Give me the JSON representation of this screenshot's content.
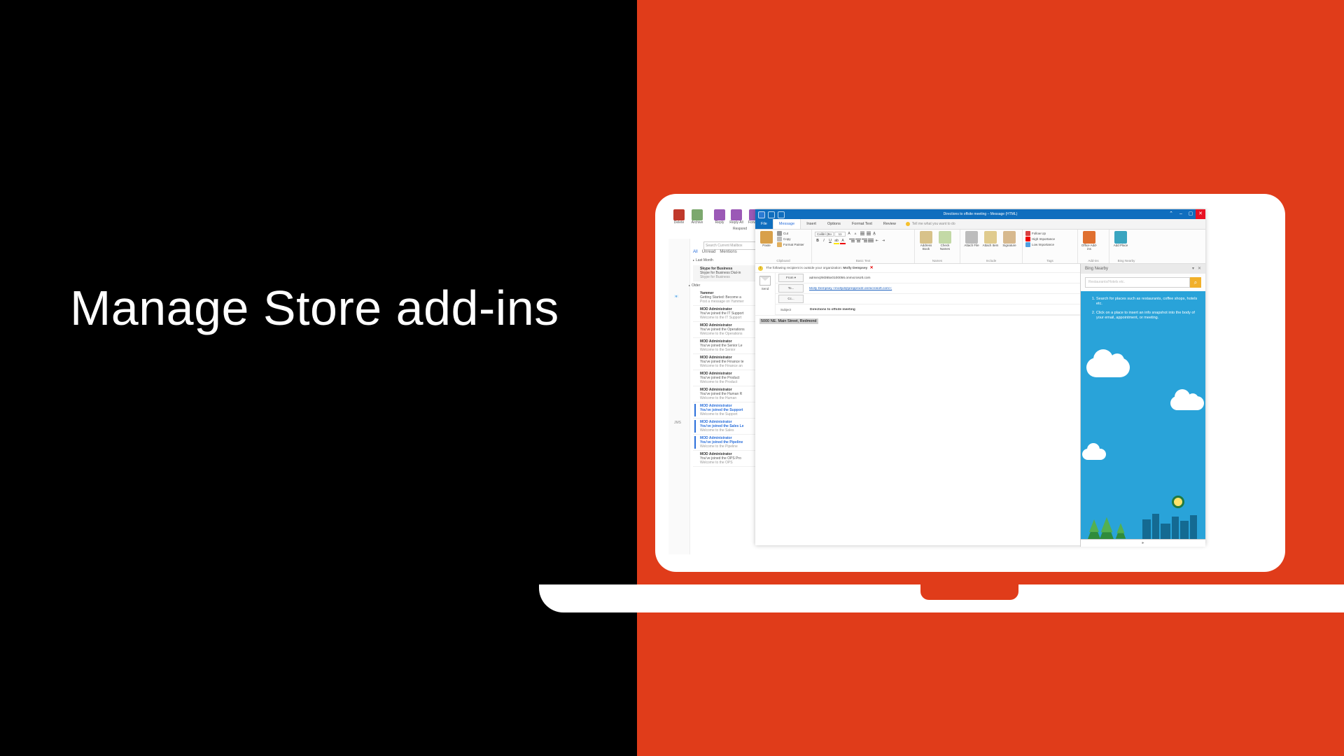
{
  "slide_title": "Manage Store add-ins",
  "outlook_back": {
    "toolbar": [
      {
        "label": "Delete"
      },
      {
        "label": "Archive"
      },
      {
        "label": "Reply"
      },
      {
        "label": "Reply All"
      },
      {
        "label": "Forward"
      }
    ],
    "response_label": "Respond",
    "search_placeholder": "Search Current Mailbox",
    "filters": [
      "All",
      "Unread",
      "Mentions"
    ],
    "group_last_month": "Last Month",
    "group_older": "Older",
    "rail_text_letters": "JMS",
    "messages": [
      {
        "sender": "Skype for Business",
        "subject": "Skype for Business Dial-in",
        "preview": "Skype for Business"
      },
      {
        "sender": "Yammer",
        "subject": "Getting Started: Become a",
        "preview": "Post a message on Yammer"
      },
      {
        "sender": "MOD Administrator",
        "subject": "You've joined the IT Support",
        "preview": "Welcome to the IT Support"
      },
      {
        "sender": "MOD Administrator",
        "subject": "You've joined the Operations",
        "preview": "Welcome to the Operations"
      },
      {
        "sender": "MOD Administrator",
        "subject": "You've joined the Senior Le",
        "preview": "Welcome to the Senior"
      },
      {
        "sender": "MOD Administrator",
        "subject": "You've joined the Finance te",
        "preview": "Welcome to the Finance an"
      },
      {
        "sender": "MOD Administrator",
        "subject": "You've joined the Product",
        "preview": "Welcome to the Product"
      },
      {
        "sender": "MOD Administrator",
        "subject": "You've joined the Human R",
        "preview": "Welcome to the Human"
      },
      {
        "sender": "MOD Administrator",
        "subject": "You've joined the Support",
        "preview": "Welcome to the Support",
        "unread": true
      },
      {
        "sender": "MOD Administrator",
        "subject": "You've joined the Sales Le",
        "preview": "Welcome to the Sales",
        "unread": true
      },
      {
        "sender": "MOD Administrator",
        "subject": "You've joined the Pipeline",
        "preview": "Welcome to the Pipeline",
        "unread": true
      },
      {
        "sender": "MOD Administrator",
        "subject": "You've joined the OPS Pro",
        "preview": "Welcome to the OPS"
      }
    ]
  },
  "compose": {
    "window_title": "Directions to offsite meeting – Message (HTML)",
    "tabs": [
      "File",
      "Message",
      "Insert",
      "Options",
      "Format Text",
      "Review"
    ],
    "tell_me": "Tell me what you want to do",
    "ribbon": {
      "clipboard": {
        "paste": "Paste",
        "cut": "Cut",
        "copy": "Copy",
        "format_painter": "Format Painter",
        "group": "Clipboard"
      },
      "basic_text": {
        "font_name": "Calibri (Bo",
        "font_size": "11",
        "group": "Basic Text"
      },
      "names": {
        "address_book": "Address Book",
        "check_names": "Check Names",
        "group": "Names"
      },
      "include": {
        "attach_file": "Attach File",
        "attach_item": "Attach Item",
        "signature": "Signature",
        "group": "Include"
      },
      "tags": {
        "follow_up": "Follow Up",
        "high_importance": "High Importance",
        "low_importance": "Low Importance",
        "group": "Tags"
      },
      "addins": {
        "office_addins": "Office Add-ins",
        "group": "Add-ins"
      },
      "bing": {
        "add_place": "Add Place",
        "group": "Bing Nearby"
      }
    },
    "info_bar_prefix": "The following recipient is outside your organization:",
    "info_bar_name": "Molly Dempsey",
    "from_label": "From",
    "from_value": "admin@M365x0100056.onmicrosoft.com",
    "to_label": "To...",
    "to_value": "Molly Dempsey <mollyd@prepprod2.onmicrosoft.com>;",
    "cc_label": "Cc...",
    "cc_value": "",
    "subject_label": "Subject",
    "subject_value": "Directions to offsite meeting",
    "send_label": "Send",
    "body_selected_text": "5000 NE. Main Street, Redmond"
  },
  "bing_pane": {
    "title": "Bing Nearby",
    "search_placeholder": "Restaurants/Hotels etc.",
    "search_icon": "⌕",
    "instructions": [
      "Search for places such as restaurants, coffee shops, hotels etc.",
      "Click on a place to insert an info snapshot into the body of your email, appointment, or meeting."
    ]
  }
}
